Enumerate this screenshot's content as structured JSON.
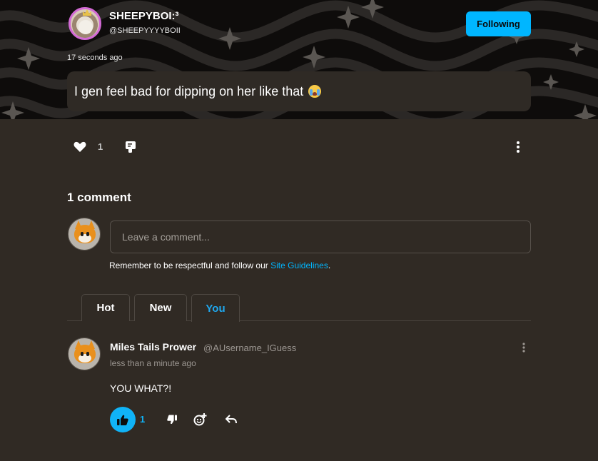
{
  "post": {
    "author_name": "SHEEPYBOI:³",
    "author_handle": "@SHEEPYYYYBOII",
    "follow_label": "Following",
    "timestamp": "17 seconds ago",
    "body_text": "I gen feel bad for dipping on her like that",
    "emoji_icon": "loudly-crying-face-icon",
    "like_count": "1"
  },
  "comments": {
    "title": "1 comment",
    "input_placeholder": "Leave a comment...",
    "guidelines_prefix": "Remember to be respectful and follow our ",
    "guidelines_link": "Site Guidelines",
    "guidelines_suffix": ".",
    "tabs": [
      {
        "label": "Hot",
        "active": false
      },
      {
        "label": "New",
        "active": false
      },
      {
        "label": "You",
        "active": true
      }
    ],
    "items": [
      {
        "author_name": "Miles Tails Prower",
        "author_handle": "@AUsername_IGuess",
        "time": "less than a minute ago",
        "text": "YOU WHAT?!",
        "like_count": "1"
      }
    ]
  },
  "colors": {
    "accent": "#00b6ff",
    "background": "#302a24",
    "banner": "#0e0c0b"
  }
}
